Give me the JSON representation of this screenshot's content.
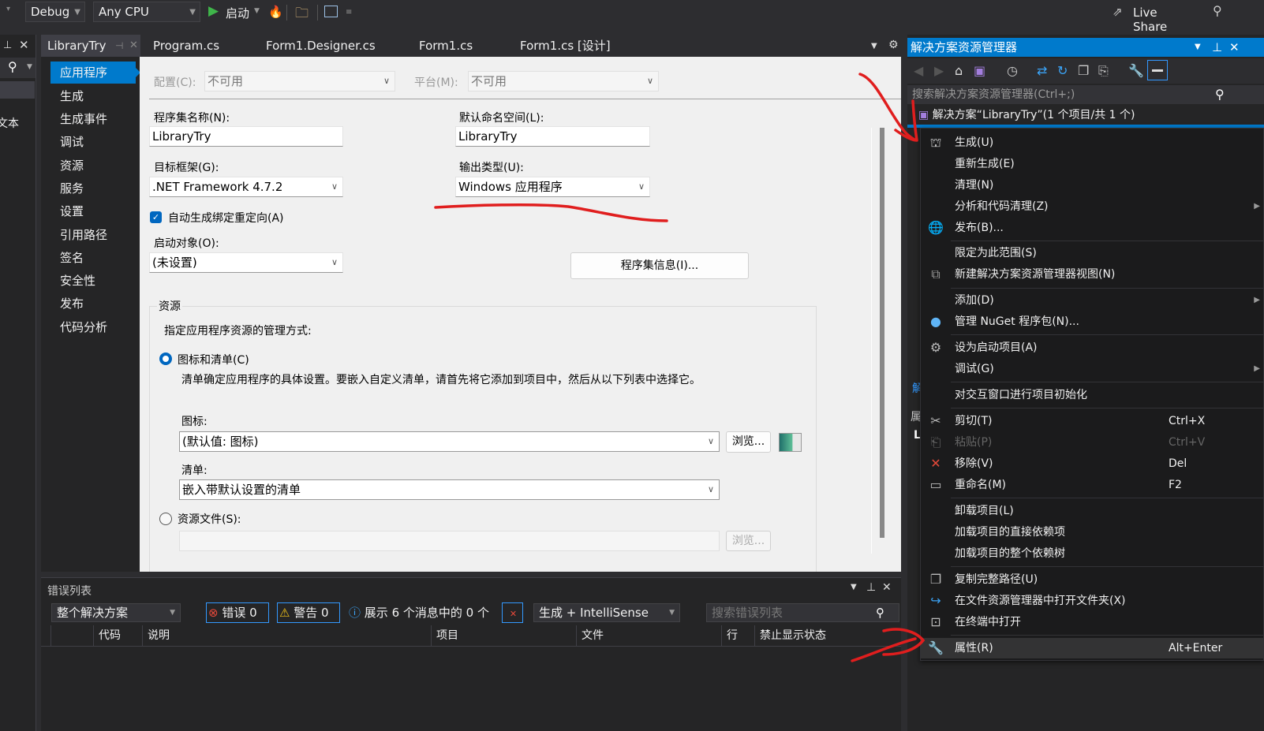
{
  "toolbar": {
    "config": "Debug",
    "platform": "Any CPU",
    "start_label": "启动",
    "live_share": "Live Share"
  },
  "left_pane": {
    "partial_text": "文本"
  },
  "tabs": [
    {
      "label": "LibraryTry",
      "active": true
    },
    {
      "label": "Program.cs"
    },
    {
      "label": "Form1.Designer.cs"
    },
    {
      "label": "Form1.cs"
    },
    {
      "label": "Form1.cs [设计]"
    }
  ],
  "designer": {
    "nav": [
      "应用程序",
      "生成",
      "生成事件",
      "调试",
      "资源",
      "服务",
      "设置",
      "引用路径",
      "签名",
      "安全性",
      "发布",
      "代码分析"
    ],
    "config_label": "配置(C):",
    "config_value": "不可用",
    "platform_label": "平台(M):",
    "platform_value": "不可用",
    "assembly_name_label": "程序集名称(N):",
    "assembly_name": "LibraryTry",
    "default_namespace_label": "默认命名空间(L):",
    "default_namespace": "LibraryTry",
    "target_framework_label": "目标框架(G):",
    "target_framework": ".NET Framework 4.7.2",
    "output_type_label": "输出类型(U):",
    "output_type": "Windows 应用程序",
    "auto_binding_label": "自动生成绑定重定向(A)",
    "auto_binding_checked": true,
    "startup_object_label": "启动对象(O):",
    "startup_object": "(未设置)",
    "assembly_info_button": "程序集信息(I)...",
    "resources_group": "资源",
    "resources_desc": "指定应用程序资源的管理方式:",
    "icon_manifest_radio": "图标和清单(C)",
    "manifest_desc": "清单确定应用程序的具体设置。要嵌入自定义清单，请首先将它添加到项目中，然后从以下列表中选择它。",
    "icon_label": "图标:",
    "icon_value": "(默认值: 图标)",
    "browse_label": "浏览...",
    "manifest_label": "清单:",
    "manifest_value": "嵌入带默认设置的清单",
    "resource_file_radio": "资源文件(S):",
    "resource_file_value": ""
  },
  "solution_explorer": {
    "title": "解决方案资源管理器",
    "search_placeholder": "搜索解决方案资源管理器(Ctrl+;)",
    "root": "解决方案“LibraryTry”(1 个项目/共 1 个)",
    "peek_1": "解",
    "peek_2": "属",
    "peek_3": "L"
  },
  "context_menu": {
    "items": [
      {
        "label": "生成(U)",
        "icon": "build-icon"
      },
      {
        "label": "重新生成(E)"
      },
      {
        "label": "清理(N)"
      },
      {
        "label": "分析和代码清理(Z)",
        "submenu": true
      },
      {
        "label": "发布(B)...",
        "icon": "publish-globe-icon"
      },
      {
        "label": "限定为此范围(S)"
      },
      {
        "label": "新建解决方案资源管理器视图(N)",
        "icon": "new-view-icon"
      },
      {
        "label": "添加(D)",
        "submenu": true
      },
      {
        "label": "管理 NuGet 程序包(N)...",
        "icon": "nuget-icon"
      },
      {
        "label": "设为启动项目(A)",
        "icon": "gear-icon"
      },
      {
        "label": "调试(G)",
        "submenu": true
      },
      {
        "label": "对交互窗口进行项目初始化"
      },
      {
        "label": "剪切(T)",
        "shortcut": "Ctrl+X",
        "icon": "scissors-icon"
      },
      {
        "label": "粘贴(P)",
        "shortcut": "Ctrl+V",
        "icon": "paste-icon",
        "disabled": true
      },
      {
        "label": "移除(V)",
        "shortcut": "Del",
        "icon": "remove-x-icon"
      },
      {
        "label": "重命名(M)",
        "shortcut": "F2",
        "icon": "rename-icon"
      },
      {
        "label": "卸载项目(L)"
      },
      {
        "label": "加载项目的直接依赖项"
      },
      {
        "label": "加载项目的整个依赖树"
      },
      {
        "label": "复制完整路径(U)",
        "icon": "copy-path-icon"
      },
      {
        "label": "在文件资源管理器中打开文件夹(X)",
        "icon": "open-folder-arrow-icon"
      },
      {
        "label": "在终端中打开",
        "icon": "terminal-icon"
      },
      {
        "label": "属性(R)",
        "shortcut": "Alt+Enter",
        "icon": "wrench-icon",
        "highlighted": true
      }
    ]
  },
  "error_list": {
    "title": "错误列表",
    "scope": "整个解决方案",
    "errors": "错误 0",
    "warnings": "警告 0",
    "messages": "展示 6 个消息中的 0 个",
    "source": "生成 + IntelliSense",
    "search_placeholder": "搜索错误列表",
    "columns": [
      "代码",
      "说明",
      "项目",
      "文件",
      "行",
      "禁止显示状态"
    ]
  },
  "colors": {
    "accent": "#007acc",
    "annotation": "#e01e1e"
  }
}
